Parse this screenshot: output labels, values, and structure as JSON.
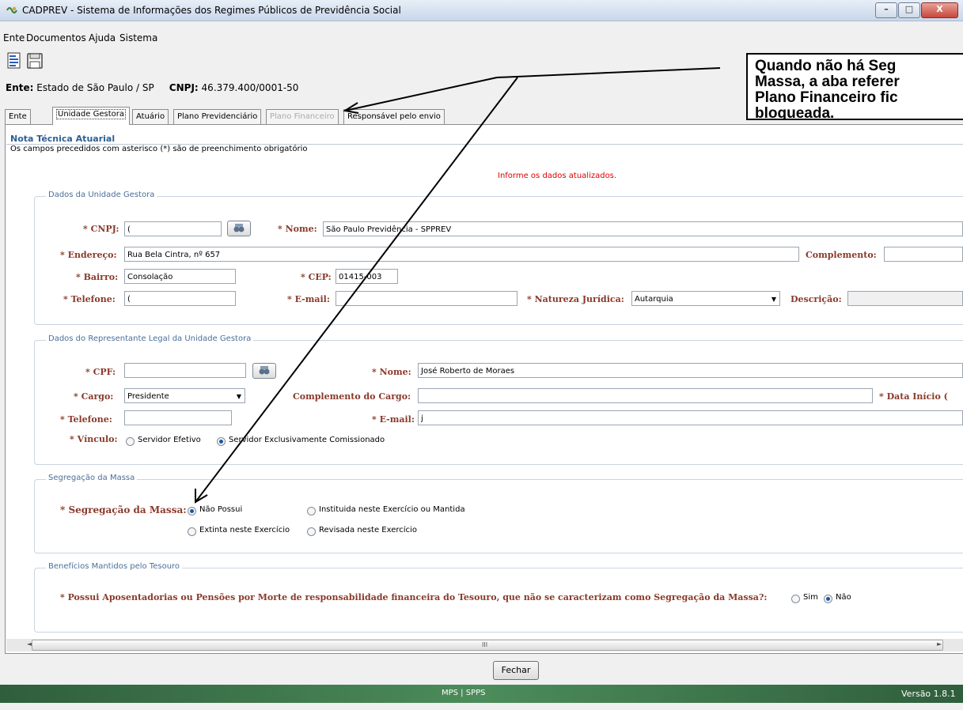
{
  "window": {
    "title": "CADPREV - Sistema de Informações dos Regimes Públicos de Previdência Social",
    "minimize": "–",
    "maximize": "□",
    "close": "X"
  },
  "menu": [
    "Ente",
    "Documentos",
    "Ajuda",
    "Sistema"
  ],
  "toolbar": {
    "icons": [
      "document-icon",
      "save-icon"
    ]
  },
  "ente": {
    "ente_label": "Ente:",
    "ente_value": "Estado de São Paulo / SP",
    "cnpj_label": "CNPJ:",
    "cnpj_value": "46.379.400/0001-50"
  },
  "tabs": [
    {
      "label": "Ente",
      "state": "normal"
    },
    {
      "label": "Unidade Gestora",
      "state": "active"
    },
    {
      "label": "Atuário",
      "state": "normal"
    },
    {
      "label": "Plano Previdenciário",
      "state": "normal"
    },
    {
      "label": "Plano Financeiro",
      "state": "disabled"
    },
    {
      "label": "Responsável pelo envio",
      "state": "normal"
    }
  ],
  "form": {
    "section_title": "Nota Técnica Atuarial",
    "subtitle": "Os campos precedidos com asterisco (*) são de preenchimento obrigatório",
    "info": "Informe os dados atualizados.",
    "unidade": {
      "title": "Dados da Unidade Gestora",
      "cnpj_label": "* CNPJ:",
      "cnpj_value": "(",
      "nome_label": "* Nome:",
      "nome_value": "São Paulo Previdência - SPPREV",
      "endereco_label": "* Endereço:",
      "endereco_value": "Rua Bela Cintra, nº 657",
      "complemento_label": "Complemento:",
      "complemento_value": "",
      "bairro_label": "* Bairro:",
      "bairro_value": "Consolação",
      "cep_label": "* CEP:",
      "cep_value": "01415-003",
      "telefone_label": "* Telefone:",
      "telefone_value": "(",
      "email_label": "* E-mail:",
      "email_value": "",
      "natureza_label": "* Natureza Jurídica:",
      "natureza_value": "Autarquia",
      "descricao_label": "Descrição:",
      "descricao_value": ""
    },
    "representante": {
      "title": "Dados do Representante Legal da Unidade Gestora",
      "cpf_label": "* CPF:",
      "cpf_value": "",
      "nome_label": "* Nome:",
      "nome_value": "José Roberto de Moraes",
      "cargo_label": "* Cargo:",
      "cargo_value": "Presidente",
      "complemento_label": "Complemento do Cargo:",
      "complemento_value": "",
      "data_label": "* Data Início (",
      "telefone_label": "* Telefone:",
      "telefone_value": "",
      "email_label": "* E-mail:",
      "email_value": "j",
      "vinculo_label": "* Vínculo:",
      "vinculo_options": [
        "Servidor Efetivo",
        "Servidor Exclusivamente Comissionado"
      ],
      "vinculo_selected": "Servidor Exclusivamente Comissionado"
    },
    "segregacao": {
      "title": "Segregação da Massa",
      "label": "* Segregação da Massa:",
      "options": [
        "Não Possui",
        "Instituida neste Exercício ou Mantida",
        "Extinta neste Exercício",
        "Revisada neste Exercício"
      ],
      "selected": "Não Possui"
    },
    "beneficios": {
      "title": "Benefícios Mantidos pelo Tesouro",
      "question": "* Possui Aposentadorias ou Pensões por Morte de responsabilidade financeira do Tesouro, que não se caracterizam como Segregação da Massa?:",
      "options": [
        "Sim",
        "Não"
      ],
      "selected": "Não"
    }
  },
  "scrollbar": {
    "grip": "III",
    "left_arrow": "◄",
    "right_arrow": "►"
  },
  "buttons": {
    "fechar": "Fechar"
  },
  "status": {
    "center": "MPS | SPPS",
    "version": "Versão 1.8.1"
  },
  "annotation": {
    "text": "Quando não há Seg\nMassa, a aba referer\nPlano Financeiro fic\nbloqueada."
  }
}
